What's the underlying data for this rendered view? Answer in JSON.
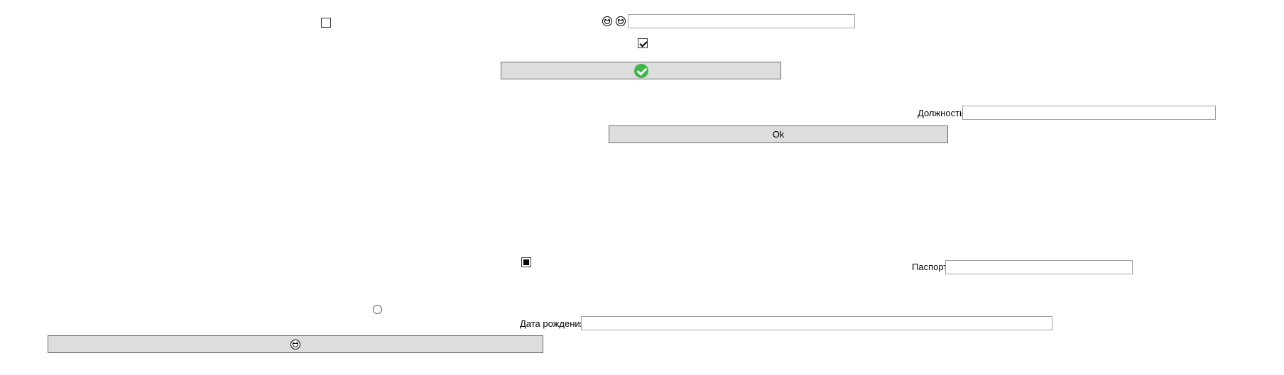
{
  "labels": {
    "position": "Должность",
    "passport": "Паспорт",
    "birth_date": "Дата рождения"
  },
  "buttons": {
    "ok": "Ok"
  },
  "fields": {
    "top_text": "",
    "position": "",
    "passport": "",
    "birth_date": ""
  },
  "checkboxes": {
    "top_left": false,
    "center": true,
    "mid": "indeterminate"
  },
  "radio": {
    "selected": false
  },
  "icons": {
    "confirm": "check-circle-icon",
    "emoji_1": "grinning-face-icon",
    "emoji_2": "smiling-face-icon",
    "button_emoji": "grinning-face-icon"
  },
  "colors": {
    "button_bg": "#dddddd",
    "button_border": "#707070",
    "field_border": "#a0a0a0",
    "check_green": "#3fb64a"
  }
}
